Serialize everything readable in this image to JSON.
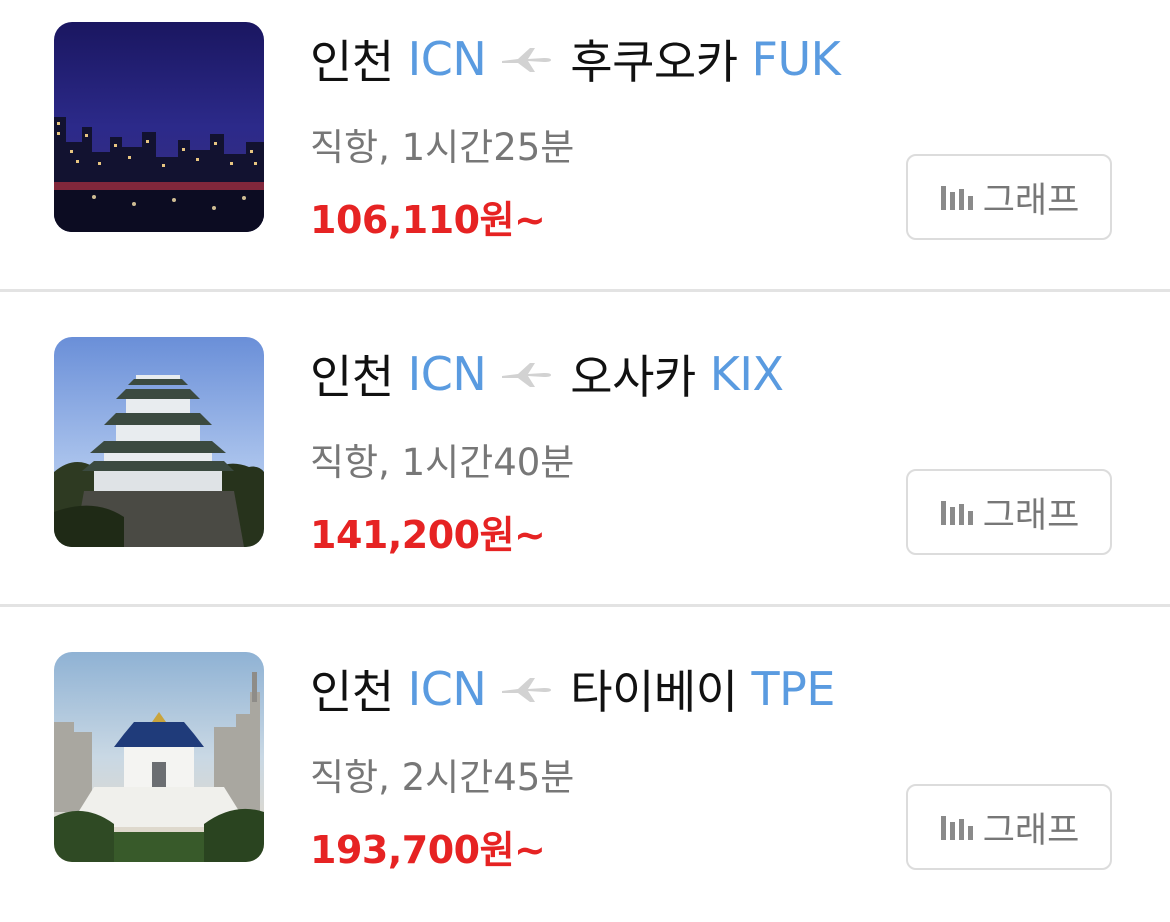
{
  "flights": [
    {
      "origin_city": "인천",
      "origin_code": "ICN",
      "dest_city": "후쿠오카",
      "dest_code": "FUK",
      "duration": "직항, 1시간25분",
      "price": "106,110원~",
      "graph_label": "그래프",
      "thumbnail": "night-city-skyline"
    },
    {
      "origin_city": "인천",
      "origin_code": "ICN",
      "dest_city": "오사카",
      "dest_code": "KIX",
      "duration": "직항, 1시간40분",
      "price": "141,200원~",
      "graph_label": "그래프",
      "thumbnail": "osaka-castle"
    },
    {
      "origin_city": "인천",
      "origin_code": "ICN",
      "dest_city": "타이베이",
      "dest_code": "TPE",
      "duration": "직항, 2시간45분",
      "price": "193,700원~",
      "graph_label": "그래프",
      "thumbnail": "memorial-hall"
    }
  ],
  "icons": {
    "route_separator": "airplane-icon",
    "graph": "bar-chart-icon"
  },
  "colors": {
    "city_code": "#5a9be0",
    "price": "#e62323",
    "secondary_text": "#777777",
    "divider": "#e3e3e3"
  }
}
